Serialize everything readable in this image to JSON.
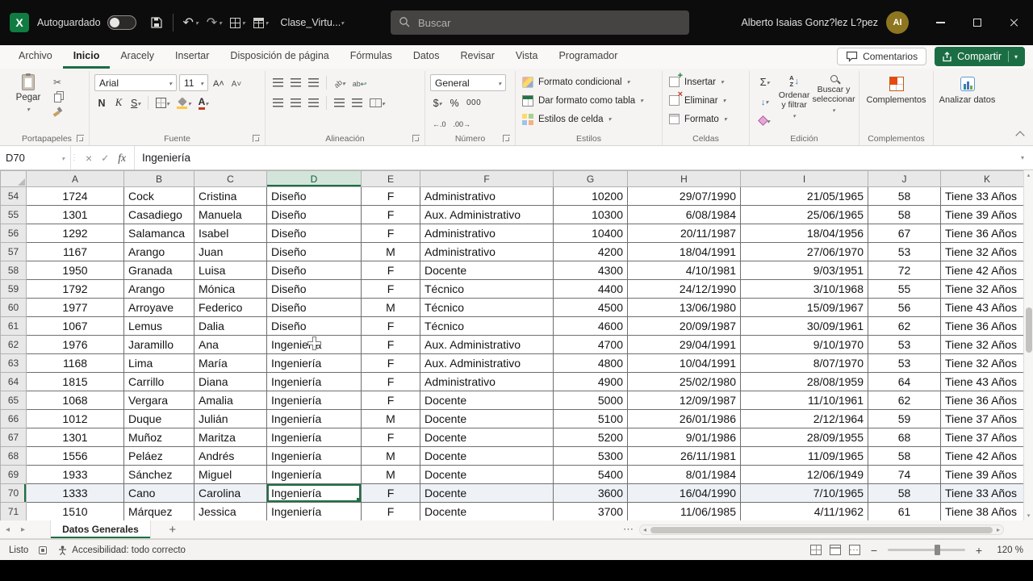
{
  "colors": {
    "accent_green": "#217346",
    "share_button": "#1b6e44",
    "selection_border": "#1e7145",
    "titlebar": "#0c0c0c"
  },
  "icons": {
    "search": "magnifier",
    "save": "floppy",
    "undo": "curved-arrow-left",
    "redo": "curved-arrow-right",
    "close": "x",
    "maximize": "square",
    "minimize": "dash"
  },
  "titlebar": {
    "autosave": "Autoguardado",
    "file_name": "Clase_Virtu...",
    "search_placeholder": "Buscar",
    "user_name": "Alberto Isaias Gonz?lez L?pez",
    "user_initials": "AI"
  },
  "tabs": {
    "items": [
      "Archivo",
      "Inicio",
      "Aracely",
      "Insertar",
      "Disposición de página",
      "Fórmulas",
      "Datos",
      "Revisar",
      "Vista",
      "Programador"
    ],
    "active": "Inicio",
    "comments": "Comentarios",
    "share": "Compartir"
  },
  "ribbon": {
    "paste": "Pegar",
    "font_name": "Arial",
    "font_size": "11",
    "bold": "N",
    "italic": "K",
    "underline": "S",
    "number_format": "General",
    "currency": "$",
    "percent": "%",
    "thousands": "000",
    "cond_format": "Formato condicional",
    "format_table": "Dar formato como tabla",
    "cell_styles": "Estilos de celda",
    "insert": "Insertar",
    "delete": "Eliminar",
    "format": "Formato",
    "autosum": "Σ",
    "sort_filter": "Ordenar y filtrar",
    "find_select": "Buscar y seleccionar",
    "addins": "Complementos",
    "analyze": "Analizar datos",
    "group_labels": [
      "Portapapeles",
      "Fuente",
      "Alineación",
      "Número",
      "Estilos",
      "Celdas",
      "Edición",
      "Complementos"
    ]
  },
  "formula_bar": {
    "name_box": "D70",
    "fx": "fx",
    "value": "Ingeniería"
  },
  "grid": {
    "column_headers": [
      "A",
      "B",
      "C",
      "D",
      "E",
      "F",
      "G",
      "H",
      "I",
      "J",
      "K"
    ],
    "selected_column": "D",
    "selected_row": 70,
    "rows": [
      {
        "n": 54,
        "cells": [
          "1724",
          "Cock",
          "Cristina",
          "Diseño",
          "F",
          "Administrativo",
          "10200",
          "29/07/1990",
          "21/05/1965",
          "58",
          "Tiene 33 Años"
        ]
      },
      {
        "n": 55,
        "cells": [
          "1301",
          "Casadiego",
          "Manuela",
          "Diseño",
          "F",
          "Aux. Administrativo",
          "10300",
          "6/08/1984",
          "25/06/1965",
          "58",
          "Tiene 39 Años"
        ]
      },
      {
        "n": 56,
        "cells": [
          "1292",
          "Salamanca",
          "Isabel",
          "Diseño",
          "F",
          "Administrativo",
          "10400",
          "20/11/1987",
          "18/04/1956",
          "67",
          "Tiene 36 Años"
        ]
      },
      {
        "n": 57,
        "cells": [
          "1167",
          "Arango",
          "Juan",
          "Diseño",
          "M",
          "Administrativo",
          "4200",
          "18/04/1991",
          "27/06/1970",
          "53",
          "Tiene 32 Años"
        ]
      },
      {
        "n": 58,
        "cells": [
          "1950",
          "Granada",
          "Luisa",
          "Diseño",
          "F",
          "Docente",
          "4300",
          "4/10/1981",
          "9/03/1951",
          "72",
          "Tiene 42 Años"
        ]
      },
      {
        "n": 59,
        "cells": [
          "1792",
          "Arango",
          "Mónica",
          "Diseño",
          "F",
          "Técnico",
          "4400",
          "24/12/1990",
          "3/10/1968",
          "55",
          "Tiene 32 Años"
        ]
      },
      {
        "n": 60,
        "cells": [
          "1977",
          "Arroyave",
          "Federico",
          "Diseño",
          "M",
          "Técnico",
          "4500",
          "13/06/1980",
          "15/09/1967",
          "56",
          "Tiene 43 Años"
        ]
      },
      {
        "n": 61,
        "cells": [
          "1067",
          "Lemus",
          "Dalia",
          "Diseño",
          "F",
          "Técnico",
          "4600",
          "20/09/1987",
          "30/09/1961",
          "62",
          "Tiene 36 Años"
        ]
      },
      {
        "n": 62,
        "cells": [
          "1976",
          "Jaramillo",
          "Ana",
          "Ingeniería",
          "F",
          "Aux. Administrativo",
          "4700",
          "29/04/1991",
          "9/10/1970",
          "53",
          "Tiene 32 Años"
        ]
      },
      {
        "n": 63,
        "cells": [
          "1168",
          "Lima",
          "María",
          "Ingeniería",
          "F",
          "Aux. Administrativo",
          "4800",
          "10/04/1991",
          "8/07/1970",
          "53",
          "Tiene 32 Años"
        ]
      },
      {
        "n": 64,
        "cells": [
          "1815",
          "Carrillo",
          "Diana",
          "Ingeniería",
          "F",
          "Administrativo",
          "4900",
          "25/02/1980",
          "28/08/1959",
          "64",
          "Tiene 43 Años"
        ]
      },
      {
        "n": 65,
        "cells": [
          "1068",
          "Vergara",
          "Amalia",
          "Ingeniería",
          "F",
          "Docente",
          "5000",
          "12/09/1987",
          "11/10/1961",
          "62",
          "Tiene 36 Años"
        ]
      },
      {
        "n": 66,
        "cells": [
          "1012",
          "Duque",
          "Julián",
          "Ingeniería",
          "M",
          "Docente",
          "5100",
          "26/01/1986",
          "2/12/1964",
          "59",
          "Tiene 37 Años"
        ]
      },
      {
        "n": 67,
        "cells": [
          "1301",
          "Muñoz",
          "Maritza",
          "Ingeniería",
          "F",
          "Docente",
          "5200",
          "9/01/1986",
          "28/09/1955",
          "68",
          "Tiene 37 Años"
        ]
      },
      {
        "n": 68,
        "cells": [
          "1556",
          "Peláez",
          "Andrés",
          "Ingeniería",
          "M",
          "Docente",
          "5300",
          "26/11/1981",
          "11/09/1965",
          "58",
          "Tiene 42 Años"
        ]
      },
      {
        "n": 69,
        "cells": [
          "1933",
          "Sánchez",
          "Miguel",
          "Ingeniería",
          "M",
          "Docente",
          "5400",
          "8/01/1984",
          "12/06/1949",
          "74",
          "Tiene 39 Años"
        ]
      },
      {
        "n": 70,
        "cells": [
          "1333",
          "Cano",
          "Carolina",
          "Ingeniería",
          "F",
          "Docente",
          "3600",
          "16/04/1990",
          "7/10/1965",
          "58",
          "Tiene 33 Años"
        ]
      },
      {
        "n": 71,
        "cells": [
          "1510",
          "Márquez",
          "Jessica",
          "Ingeniería",
          "F",
          "Docente",
          "3700",
          "11/06/1985",
          "4/11/1962",
          "61",
          "Tiene 38 Años"
        ]
      }
    ]
  },
  "sheet_bar": {
    "tab": "Datos Generales",
    "add": "+"
  },
  "status_bar": {
    "mode": "Listo",
    "accessibility": "Accesibilidad: todo correcto",
    "zoom": "120 %"
  }
}
